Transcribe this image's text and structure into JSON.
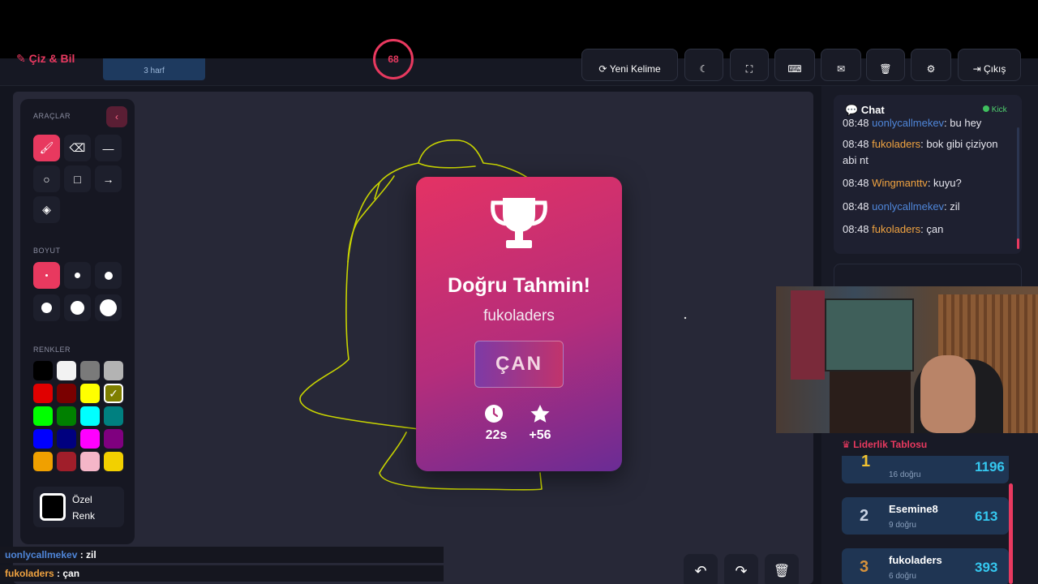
{
  "header": {
    "logo": "Çiz & Bil",
    "word_hint": "3 harf",
    "timer": "68",
    "new_word_label": "Yeni Kelime",
    "exit_label": "Çıkış"
  },
  "tools": {
    "tools_title": "ARAÇLAR",
    "size_title": "BOYUT",
    "colors_title": "RENKLER",
    "custom_color_line1": "Özel",
    "custom_color_line2": "Renk",
    "colors": [
      "#000000",
      "#f2f2f2",
      "#7a7a7a",
      "#b3b3b3",
      "#e00000",
      "#7a0000",
      "#ffff00",
      "#7f7f00",
      "#00ff00",
      "#008000",
      "#00ffff",
      "#008080",
      "#0000ff",
      "#00007f",
      "#ff00ff",
      "#7f007f",
      "#f0a000",
      "#a01e2a",
      "#f5b6c8",
      "#f2d000"
    ]
  },
  "modal": {
    "title": "Doğru Tahmin!",
    "user": "fukoladers",
    "word": "ÇAN",
    "time": "22s",
    "points": "+56"
  },
  "chat": {
    "title": "Chat",
    "kick_label": "Kick",
    "messages": [
      {
        "time": "08:48",
        "user": "uonlycallmekev",
        "text": ": bu hey"
      },
      {
        "time": "08:48",
        "user": "fukoladers",
        "text": ": bok gibi çiziyon abi nt"
      },
      {
        "time": "08:48",
        "user": "Wingmanttv",
        "text": ": kuyu?"
      },
      {
        "time": "08:48",
        "user": "uonlycallmekev",
        "text": ": zil"
      },
      {
        "time": "08:48",
        "user": "fukoladers",
        "text": ": çan"
      }
    ]
  },
  "leaderboard": {
    "title": "Liderlik Tablosu",
    "rows": [
      {
        "rank": "1",
        "name": "",
        "sub": "16 doğru",
        "score": "1196"
      },
      {
        "rank": "2",
        "name": "Esemine8",
        "sub": "9 doğru",
        "score": "613"
      },
      {
        "rank": "3",
        "name": "fukoladers",
        "sub": "6 doğru",
        "score": "393"
      }
    ]
  },
  "overlay": {
    "line1_user": "uonlycallmekev",
    "line1_text": " : zil",
    "line2_user": "fukoladers",
    "line2_text": " : çan"
  },
  "colors": {
    "accent": "#e8395f",
    "bg": "#13151f",
    "canvas": "#272837",
    "sketch": "#c8d400"
  }
}
